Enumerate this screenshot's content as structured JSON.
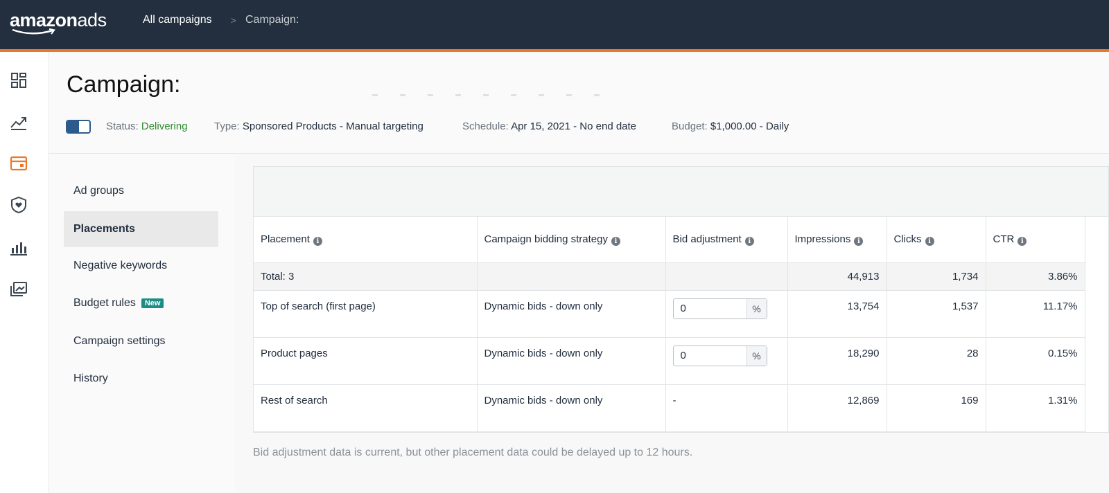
{
  "brand": {
    "logo_main": "amazon",
    "logo_ads": "ads"
  },
  "breadcrumb": {
    "all_campaigns": "All campaigns",
    "separator": ">",
    "current": "Campaign:"
  },
  "rail": {
    "icons": [
      "dashboard-icon",
      "trend-chart-icon",
      "campaign-card-icon",
      "brand-shield-icon",
      "bar-chart-icon",
      "media-icon"
    ],
    "active_index": 2,
    "accent": "#e8782a"
  },
  "header": {
    "title": "Campaign:",
    "status_label": "Status:",
    "status_value": "Delivering",
    "type_label": "Type:",
    "type_value": "Sponsored Products - Manual targeting",
    "schedule_label": "Schedule:",
    "schedule_value": "Apr 15, 2021 - No end date",
    "budget_label": "Budget:",
    "budget_value": "$1,000.00 - Daily"
  },
  "subnav": {
    "items": [
      {
        "label": "Ad groups"
      },
      {
        "label": "Placements",
        "active": true
      },
      {
        "label": "Negative keywords"
      },
      {
        "label": "Budget rules",
        "badge": "New"
      },
      {
        "label": "Campaign settings"
      },
      {
        "label": "History"
      }
    ]
  },
  "table": {
    "columns": [
      "Placement",
      "Campaign bidding strategy",
      "Bid adjustment",
      "Impressions",
      "Clicks",
      "CTR"
    ],
    "info_glyph": "i",
    "total": {
      "label": "Total: 3",
      "impressions": "44,913",
      "clicks": "1,734",
      "ctr": "3.86%"
    },
    "rows": [
      {
        "placement": "Top of search (first page)",
        "strategy": "Dynamic bids - down only",
        "bid_value": "0",
        "bid_unit": "%",
        "impressions": "13,754",
        "clicks": "1,537",
        "ctr": "11.17%"
      },
      {
        "placement": "Product pages",
        "strategy": "Dynamic bids - down only",
        "bid_value": "0",
        "bid_unit": "%",
        "impressions": "18,290",
        "clicks": "28",
        "ctr": "0.15%"
      },
      {
        "placement": "Rest of search",
        "strategy": "Dynamic bids - down only",
        "bid_text": "-",
        "impressions": "12,869",
        "clicks": "169",
        "ctr": "1.31%"
      }
    ]
  },
  "footnote": "Bid adjustment data is current, but other placement data could be delayed up to 12 hours."
}
